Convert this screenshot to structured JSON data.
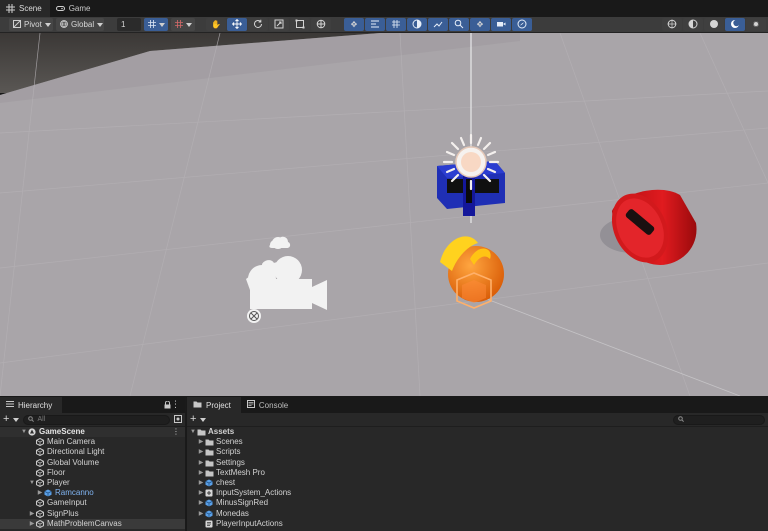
{
  "tabs": [
    {
      "label": "Scene",
      "icon": "grid-icon",
      "active": true
    },
    {
      "label": "Game",
      "icon": "gamepad-icon",
      "active": false
    }
  ],
  "toolbar": {
    "pivot_label": "Pivot",
    "global_label": "Global",
    "grid_value": "1"
  },
  "hierarchy": {
    "tab_label": "Hierarchy",
    "search_placeholder": "All",
    "items": [
      {
        "label": "GameScene",
        "depth": 0,
        "icon": "unity-scene-icon",
        "expanded": true
      },
      {
        "label": "Main Camera",
        "depth": 1,
        "icon": "gameobject-icon"
      },
      {
        "label": "Directional Light",
        "depth": 1,
        "icon": "gameobject-icon"
      },
      {
        "label": "Global Volume",
        "depth": 1,
        "icon": "gameobject-icon"
      },
      {
        "label": "Floor",
        "depth": 1,
        "icon": "gameobject-icon"
      },
      {
        "label": "Player",
        "depth": 1,
        "icon": "gameobject-icon",
        "expanded": true
      },
      {
        "label": "Ramcanno",
        "depth": 2,
        "icon": "prefab-icon",
        "prefab": true
      },
      {
        "label": "GameInput",
        "depth": 1,
        "icon": "gameobject-icon"
      },
      {
        "label": "SignPlus",
        "depth": 1,
        "icon": "gameobject-icon",
        "collapsed": true
      },
      {
        "label": "MathProblemCanvas",
        "depth": 1,
        "icon": "gameobject-icon",
        "collapsed": true
      }
    ]
  },
  "project": {
    "tab_label": "Project",
    "console_label": "Console",
    "root": "Assets",
    "items": [
      {
        "label": "Scenes",
        "icon": "folder-icon"
      },
      {
        "label": "Scripts",
        "icon": "folder-icon"
      },
      {
        "label": "Settings",
        "icon": "folder-icon"
      },
      {
        "label": "TextMesh Pro",
        "icon": "folder-icon"
      },
      {
        "label": "chest",
        "icon": "prefab-icon"
      },
      {
        "label": "InputSystem_Actions",
        "icon": "input-actions-icon"
      },
      {
        "label": "MinusSignRed",
        "icon": "prefab-icon"
      },
      {
        "label": "Monedas",
        "icon": "prefab-icon"
      },
      {
        "label": "PlayerInputActions",
        "icon": "input-actions-icon"
      }
    ]
  },
  "colors": {
    "accent": "#3a5e96",
    "floor": "#a8a4a8",
    "panel": "#282828"
  }
}
